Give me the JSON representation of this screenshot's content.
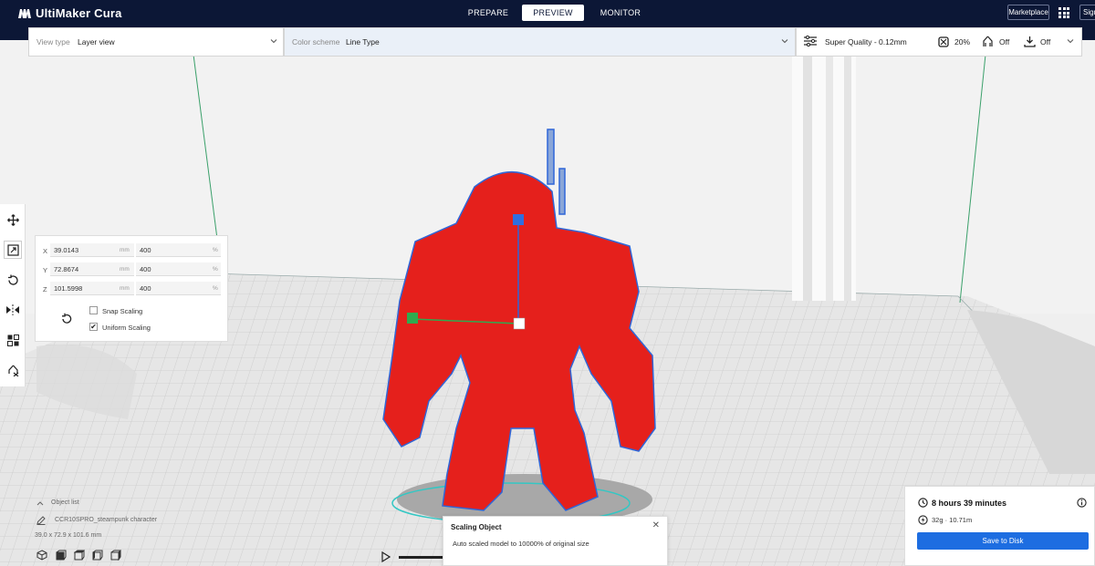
{
  "app": {
    "title": "UltiMaker Cura",
    "stages": [
      "PREPARE",
      "PREVIEW",
      "MONITOR"
    ],
    "active_stage": "PREVIEW",
    "marketplace_label": "Marketplace",
    "signin_label": "Sign"
  },
  "view_header": {
    "view_type_label": "View type",
    "view_type_value": "Layer view",
    "color_scheme_label": "Color scheme",
    "color_scheme_value": "Line Type"
  },
  "print_settings": {
    "profile": "Super Quality - 0.12mm",
    "infill": "20%",
    "support": "Off",
    "adhesion": "Off"
  },
  "scale_tool": {
    "x_label": "X",
    "x_mm": "39.0143",
    "x_pct": "400",
    "y_label": "Y",
    "y_mm": "72.8674",
    "y_pct": "400",
    "z_label": "Z",
    "z_mm": "101.5998",
    "z_pct": "400",
    "unit_mm": "mm",
    "unit_pct": "%",
    "snap_scaling_label": "Snap Scaling",
    "snap_scaling_checked": false,
    "uniform_scaling_label": "Uniform Scaling",
    "uniform_scaling_checked": true
  },
  "object_list": {
    "header": "Object list",
    "name": "CCR10SPRO_steampunk character",
    "dimensions": "39.0 x 72.9 x 101.6 mm"
  },
  "toast": {
    "title": "Scaling Object",
    "message": "Auto scaled model to 10000% of original size"
  },
  "summary": {
    "time": "8 hours 39 minutes",
    "material": "32g · 10.71m",
    "save_label": "Save to Disk"
  },
  "colors": {
    "app_bar": "#0c1736",
    "model": "#e5201c",
    "accent": "#1d6de1"
  }
}
